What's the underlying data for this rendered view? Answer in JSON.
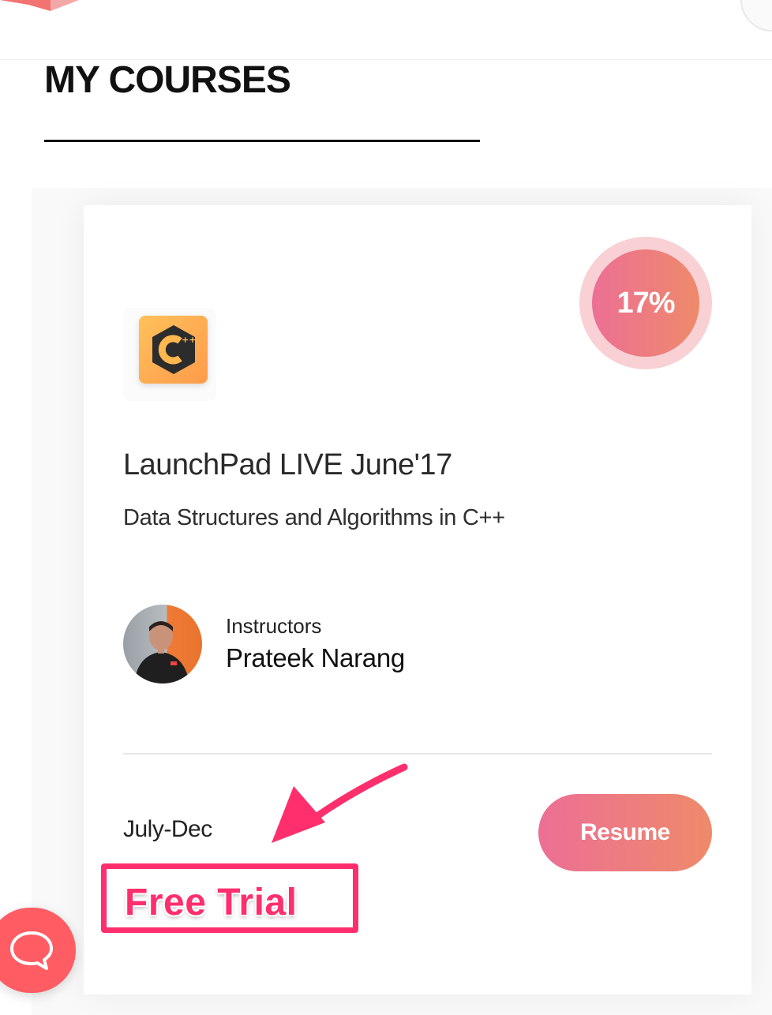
{
  "page": {
    "title": "MY COURSES"
  },
  "course": {
    "title": "LaunchPad LIVE June'17",
    "subtitle": "Data Structures and Algorithms in C++",
    "progress_label": "17%",
    "progress_fraction": 0.17,
    "icon": "cpp-language-icon",
    "instructors_label": "Instructors",
    "instructor_name": "Prateek Narang",
    "batch": "July-Dec",
    "resume_label": "Resume"
  },
  "annotation": {
    "label": "Free Trial",
    "color": "#ff2f6e"
  },
  "colors": {
    "accent_start": "#ec6f95",
    "accent_end": "#ee8a6a",
    "progress_ring": "#f9d0d3",
    "chat": "#ff5c63"
  },
  "icons": {
    "chat": "chat-bubble-icon"
  }
}
